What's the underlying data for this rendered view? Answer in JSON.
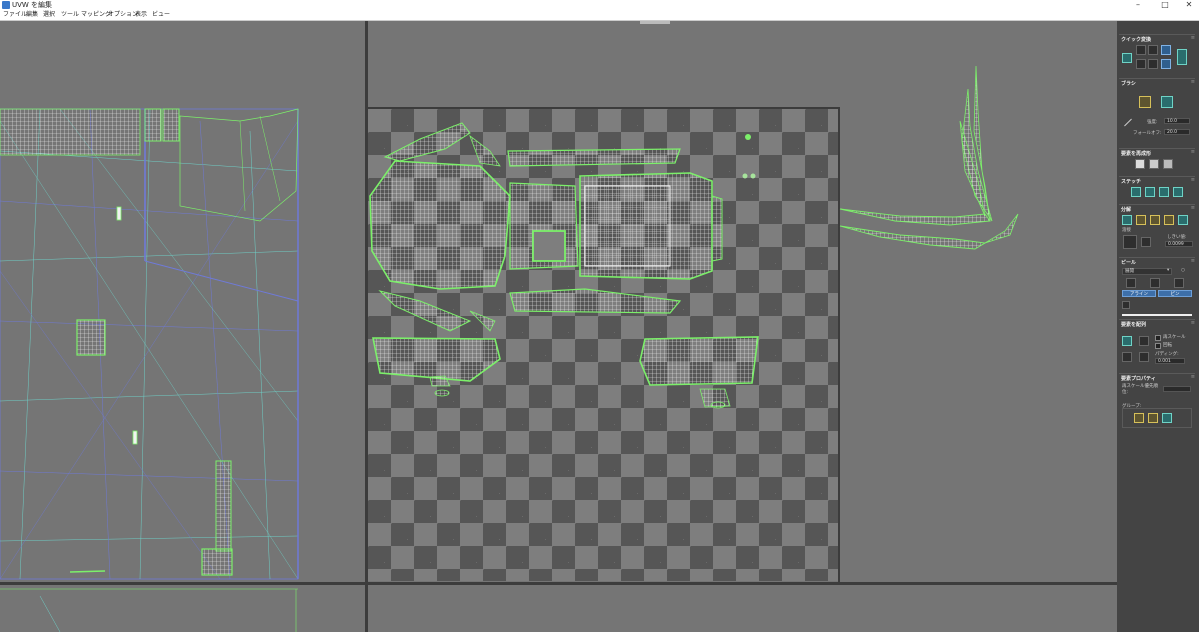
{
  "window": {
    "title": "UVW を編集",
    "minimize": "–",
    "maximize": "□",
    "close": "✕"
  },
  "menu": [
    "ファイル",
    "編集",
    "選択",
    "ツール",
    "マッピング",
    "オプション",
    "表示",
    "ビュー"
  ],
  "panel": {
    "quick_transform": {
      "title": "クイック変換"
    },
    "brush": {
      "title": "ブラシ",
      "strength_label": "強度:",
      "strength_value": "10.0",
      "falloff_label": "フォールオフ:",
      "falloff_value": "20.0"
    },
    "reshape": {
      "title": "要素を再成形"
    },
    "stitch": {
      "title": "ステッチ"
    },
    "explode": {
      "title": "分解",
      "weld_label": "溶接",
      "threshold_label": "しきい値:",
      "threshold_value": "0.0099"
    },
    "peel": {
      "title": "ピール",
      "dropdown_value": "展開",
      "align_button": "アライン",
      "pin_button": "ピン"
    },
    "arrange": {
      "title": "要素を配列",
      "rescale_label": "再スケール",
      "rotate_label": "回転",
      "padding_label": "パディング:",
      "padding_value": "0.001"
    },
    "element_properties": {
      "title": "要素プロパティ",
      "rescale_priority_label": "再スケール優先順位:",
      "group_label": "グループ:"
    }
  },
  "colors": {
    "uv_green": "#7cf06a",
    "uv_white": "#f2f2f2",
    "wire_blue": "#6f7ad8",
    "wire_cyan": "#6fd0c8",
    "accent_blue": "#3d6fa9"
  }
}
